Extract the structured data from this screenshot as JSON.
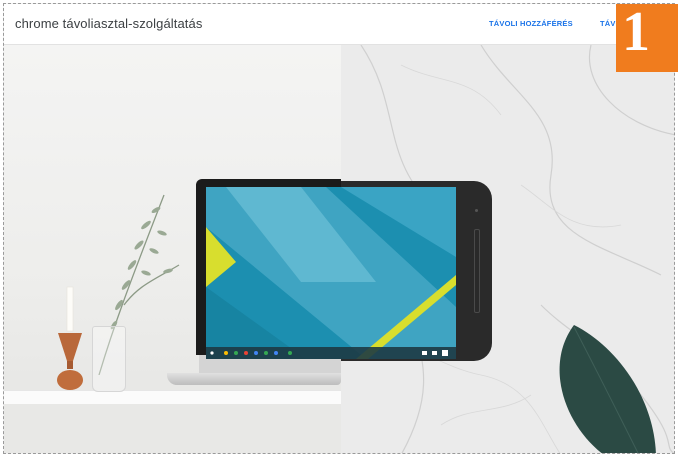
{
  "header": {
    "app_title": "chrome távoliasztal-szolgáltatás",
    "nav": [
      {
        "label": "TÁVOLI HOZZÁFÉRÉS"
      },
      {
        "label": "TÁVO"
      }
    ]
  },
  "badge": {
    "number": "1",
    "color": "#f07c1e"
  },
  "hero": {
    "description_icons": [
      "laptop-icon",
      "phone-icon",
      "plant-icon",
      "candle-icon",
      "leaf-icon"
    ]
  },
  "colors": {
    "accent": "#1a73e8",
    "screen_teal": "#1c8fb0",
    "screen_yellow": "#d8de2e",
    "leaf_green": "#2b4a44"
  }
}
